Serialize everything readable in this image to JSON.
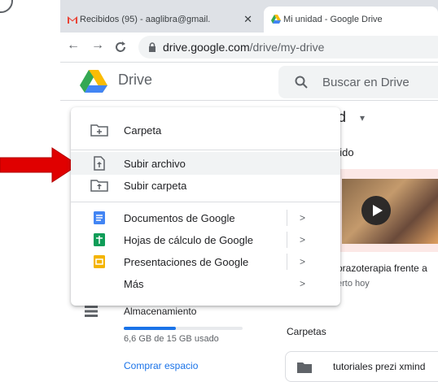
{
  "browser": {
    "tabs": [
      {
        "title": "Recibidos (95) - aaglibra@gmail.",
        "close": "✕",
        "icon": "gmail-icon"
      },
      {
        "title": "Mi unidad - Google Drive",
        "icon": "drive-icon"
      }
    ],
    "url_host": "drive.google.com",
    "url_path": "/drive/my-drive"
  },
  "header": {
    "app_name": "Drive",
    "search_placeholder": "Buscar en Drive"
  },
  "background": {
    "unit_title_fragment": "ıd",
    "quick_access_fragment": "pido",
    "video_title_fragment": "orazoterapia frente a",
    "video_sub_fragment": "erto hoy",
    "folders_label": "Carpetas",
    "folder_name": "tutoriales prezi xmind"
  },
  "sidebar": {
    "storage_label": "Almacenamiento",
    "storage_used": "6,6 GB de 15 GB usado",
    "storage_fraction": 0.44,
    "buy_storage": "Comprar espacio"
  },
  "menu": {
    "items": [
      {
        "label": "Carpeta",
        "icon": "new-folder-icon"
      },
      {
        "label": "Subir archivo",
        "icon": "file-upload-icon"
      },
      {
        "label": "Subir carpeta",
        "icon": "folder-upload-icon"
      },
      {
        "label": "Documentos de Google",
        "icon": "google-docs-icon",
        "arrow": ">"
      },
      {
        "label": "Hojas de cálculo de Google",
        "icon": "google-sheets-icon",
        "arrow": ">"
      },
      {
        "label": "Presentaciones de Google",
        "icon": "google-slides-icon",
        "arrow": ">"
      },
      {
        "label": "Más",
        "arrow": ">"
      }
    ]
  },
  "colors": {
    "accent": "#1a73e8",
    "annotation_arrow": "#e00000",
    "docs": "#4285f4",
    "sheets": "#0f9d58",
    "slides": "#f4b400"
  }
}
